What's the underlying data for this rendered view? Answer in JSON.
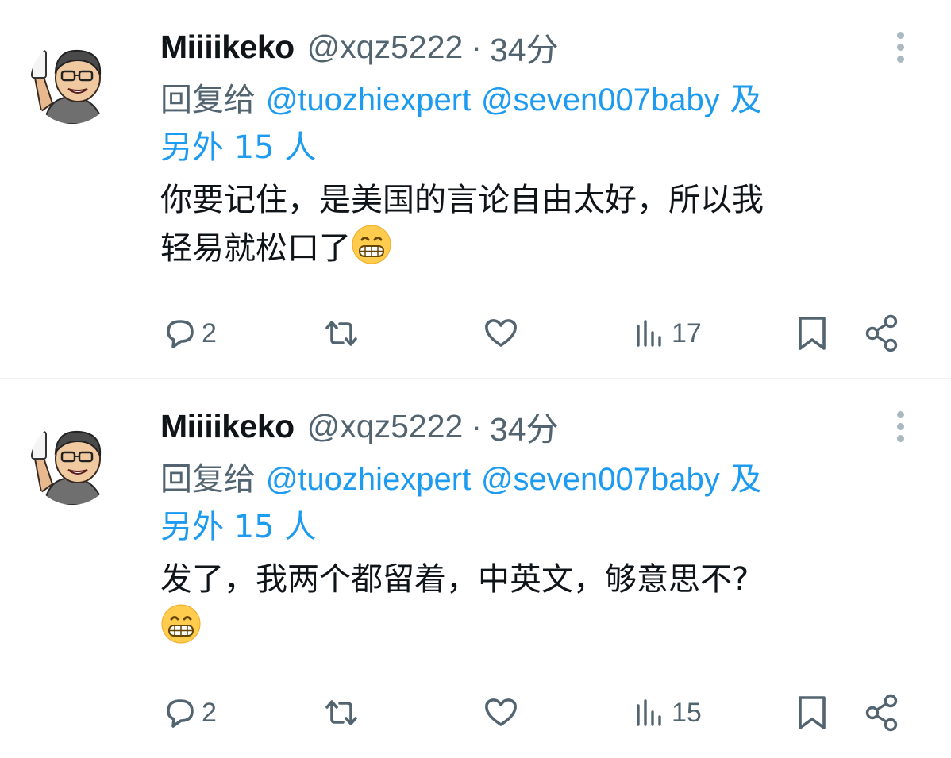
{
  "tweets": [
    {
      "author": {
        "display_name": "Miiiikeko",
        "handle": "@xqz5222",
        "separator": "·",
        "time": "34分",
        "avatar_icon": "avatar-photo"
      },
      "reply": {
        "prefix": "回复给",
        "mention_1": "@tuozhiexpert",
        "mention_2": "@seven007baby",
        "and": "及",
        "others": "另外 15 人"
      },
      "text_line_1": "你要记住，是美国的言论自由太好，所以我",
      "text_line_2": "轻易就松口了",
      "emoji": "grinning-face-icon",
      "actions": {
        "replies": "2",
        "retweets": "",
        "likes": "",
        "views": "17"
      }
    },
    {
      "author": {
        "display_name": "Miiiikeko",
        "handle": "@xqz5222",
        "separator": "·",
        "time": "34分",
        "avatar_icon": "avatar-photo"
      },
      "reply": {
        "prefix": "回复给",
        "mention_1": "@tuozhiexpert",
        "mention_2": "@seven007baby",
        "and": "及",
        "others": "另外 15 人"
      },
      "text_line_1": "发了，我两个都留着，中英文，够意思不?",
      "text_line_2": "",
      "emoji": "grinning-face-icon",
      "actions": {
        "replies": "2",
        "retweets": "",
        "likes": "",
        "views": "15"
      }
    }
  ],
  "colors": {
    "link": "#1d9bf0",
    "secondary_text": "#536471",
    "primary_text": "#0f1419",
    "divider": "#eff3f4"
  }
}
